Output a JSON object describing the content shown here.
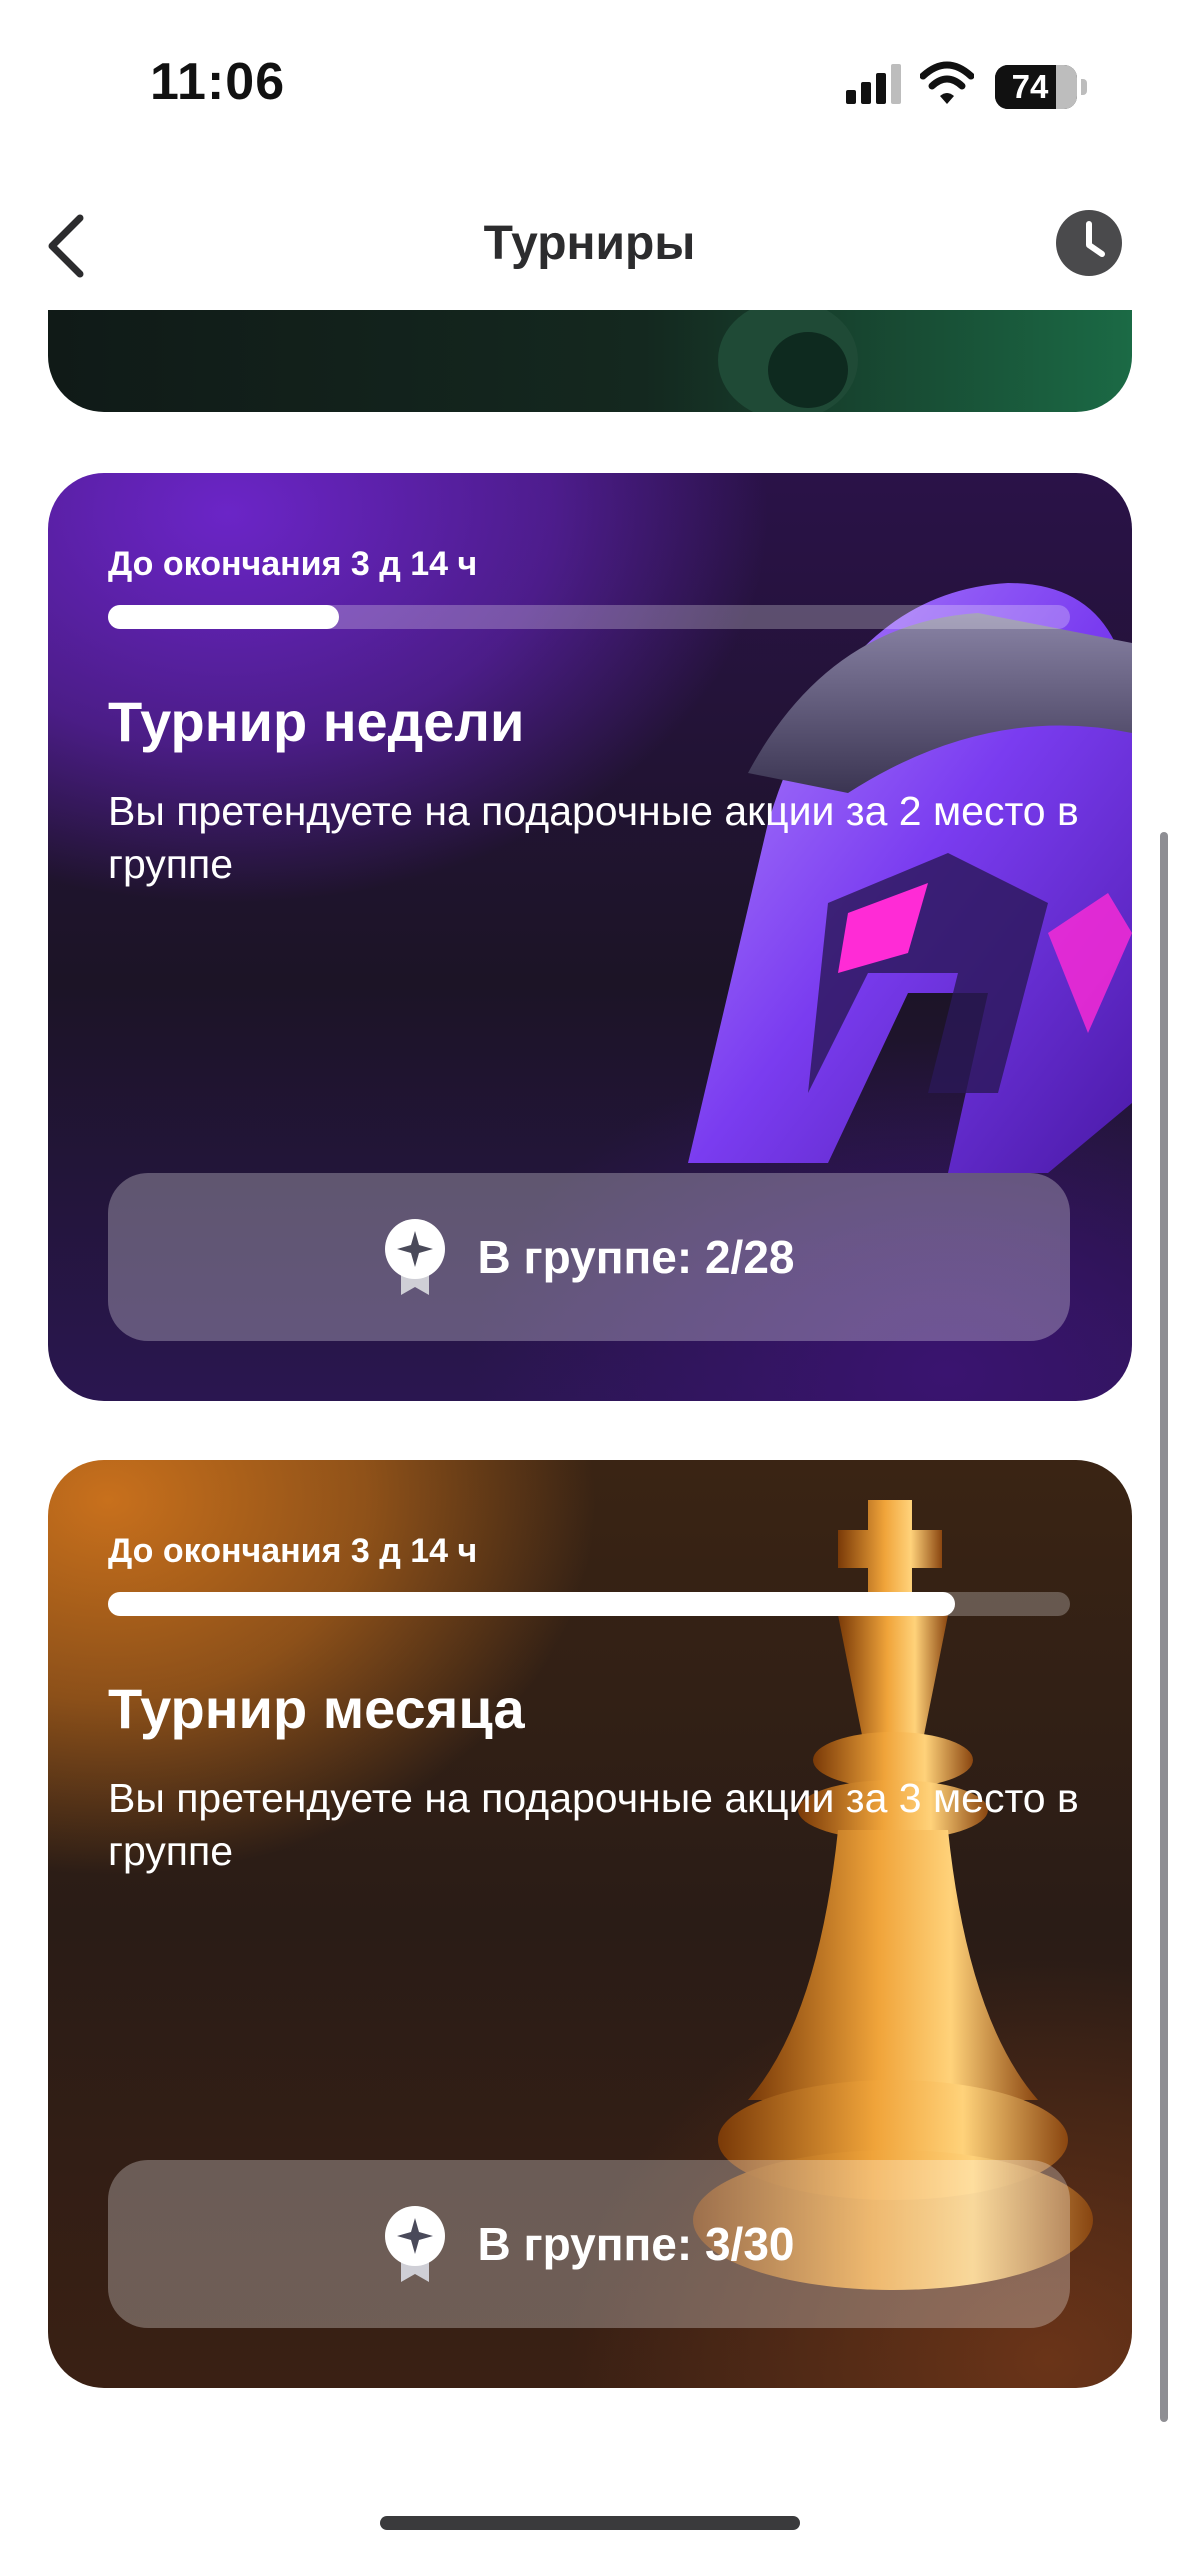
{
  "status_bar": {
    "time": "11:06",
    "signal_icon": "cellular-signal-icon",
    "wifi_icon": "wifi-icon",
    "battery_level": "74"
  },
  "nav": {
    "title": "Турниры",
    "back_icon": "chevron-left-icon",
    "history_icon": "clock-icon"
  },
  "cards": [
    {
      "id": "tournament-week",
      "time_left": "До окончания 3 д 14 ч",
      "progress": 0.24,
      "title": "Турнир недели",
      "description": "Вы претендуете на подарочные акции за 2 место в группе",
      "button_label": "В группе: 2/28",
      "button_icon": "medal-icon",
      "illustration": "helmet"
    },
    {
      "id": "tournament-month",
      "time_left": "До окончания 3 д 14 ч",
      "progress": 0.88,
      "title": "Турнир месяца",
      "description": "Вы претендуете на подарочные акции за 3 место в группе",
      "button_label": "В группе: 3/30",
      "button_icon": "medal-icon",
      "illustration": "chess-king"
    }
  ],
  "colors": {
    "week_accent": "#6b25c7",
    "month_accent": "#c8701c",
    "previous_card_accent": "#1b6a45"
  }
}
